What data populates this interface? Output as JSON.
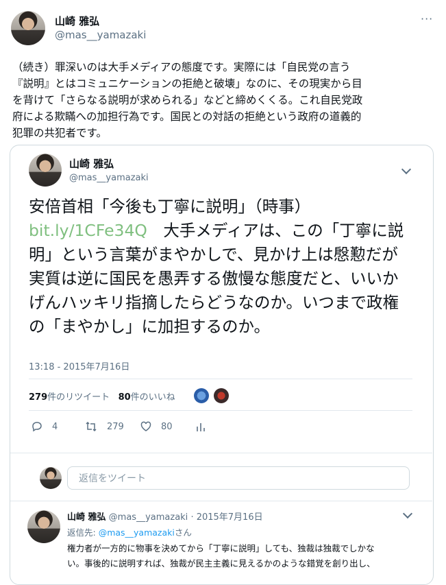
{
  "outer_tweet": {
    "author_name": "山崎 雅弘",
    "author_handle": "@mas__yamazaki",
    "text": "（続き）罪深いのは大手メディアの態度です。実際には「自民党の言う\n『説明』とはコミュニケーションの拒絶と破壊」なのに、その現実から目\nを背けて「さらなる説明が求められる」などと締めくくる。これ自民党政\n府による欺瞞への加担行為です。国民との対話の拒絶という政府の道義的\n犯罪の共犯者です。"
  },
  "quoted_tweet": {
    "author_name": "山崎 雅弘",
    "author_handle": "@mas__yamazaki",
    "text_before_link": "安倍首相「今後も丁寧に説明」（時事）",
    "link": "bit.ly/1CFe34Q",
    "text_after_link": "　大手メディアは、この「丁寧に説明」という言葉がまやかしで、見かけ上は慇懃だが実質は逆に国民を愚弄する傲慢な態度だと、いいかげんハッキリ指摘したらどうなのか。いつまで政権の「まやかし」に加担するのか。",
    "timestamp": "13:18 - 2015年7月16日",
    "retweets_count": "279",
    "retweets_label": "件のリツイート",
    "likes_count": "80",
    "likes_label": "件のいいね",
    "reply_count": "4",
    "retweet_count_action": "279",
    "like_count_action": "80"
  },
  "reply_composer": {
    "placeholder": "返信をツイート"
  },
  "reply_tweet": {
    "author_name": "山崎 雅弘",
    "author_handle": "@mas__yamazaki",
    "date": "· 2015年7月16日",
    "reply_to_label": "返信先: ",
    "reply_to_handle": "@mas__yamazaki",
    "reply_to_suffix": "さん",
    "text": "権力者が一方的に物事を決めてから「丁寧に説明」しても、独裁は独裁でしかな\nい。事後的に説明すれば、独裁が民主主義に見えるかのような錯覚を創り出し、"
  }
}
